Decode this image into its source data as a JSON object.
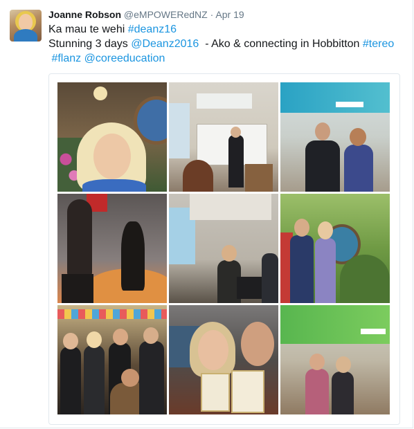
{
  "tweet": {
    "author": {
      "name": "Joanne Robson",
      "handle": "@eMPOWERedNZ",
      "separator": "·",
      "time": "Apr 19"
    },
    "text": {
      "line1_plain": "Ka mau te wehi ",
      "line1_tag": "#deanz16",
      "line2_plain1": "Stunning 3 days ",
      "line2_mention": "@Deanz2016",
      "line2_plain2": "  - Ako & connecting in Hobbitton ",
      "line2_tag": "#tereo",
      "line3_tag": "#flanz",
      "line3_mention": "@coreeducation"
    },
    "photos": [
      {
        "id": "hobbit-door-selfie"
      },
      {
        "id": "presentation-room"
      },
      {
        "id": "core-banner-pair"
      },
      {
        "id": "statue-silhouette"
      },
      {
        "id": "projector-selfie"
      },
      {
        "id": "hobbit-hole-group"
      },
      {
        "id": "party-group"
      },
      {
        "id": "certificate-selfie"
      },
      {
        "id": "core-banner-pair-2"
      }
    ]
  },
  "colors": {
    "link": "#1b95e0",
    "text": "#14171a",
    "muted": "#657786",
    "border": "#e1e8ed"
  }
}
